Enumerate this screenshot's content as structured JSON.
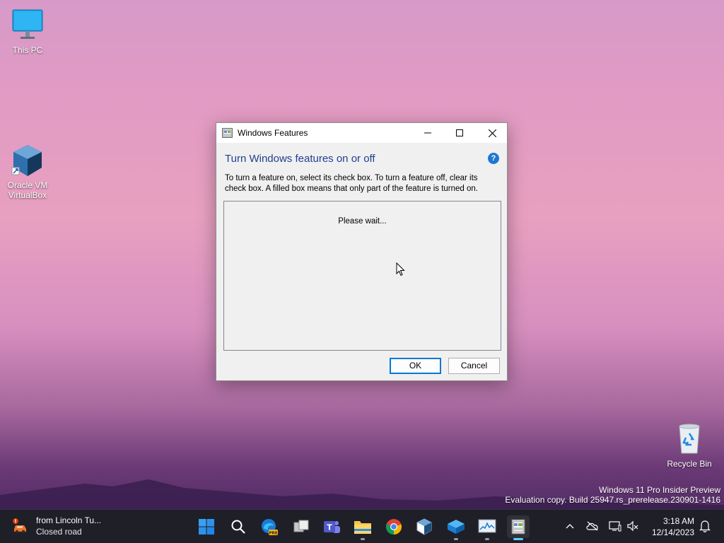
{
  "desktop": {
    "icons": [
      {
        "label": "This PC"
      },
      {
        "label": "Oracle VM VirtualBox"
      },
      {
        "label": "Recycle Bin"
      }
    ],
    "watermark": {
      "line1": "Windows 11 Pro Insider Preview",
      "line2": "Evaluation copy. Build 25947.rs_prerelease.230901-1416"
    }
  },
  "dialog": {
    "title": "Windows Features",
    "heading": "Turn Windows features on or off",
    "help_symbol": "?",
    "description": "To turn a feature on, select its check box. To turn a feature off, clear its check box. A filled box means that only part of the feature is turned on.",
    "status": "Please wait...",
    "ok_label": "OK",
    "cancel_label": "Cancel"
  },
  "taskbar": {
    "weather": {
      "line1": "from Lincoln Tu...",
      "line2": "Closed road"
    },
    "clock": {
      "time": "3:18 AM",
      "date": "12/14/2023"
    },
    "edge_badge": "PRE",
    "teams_letter": "T"
  },
  "colors": {
    "accent": "#0078d4",
    "heading": "#1f3f8f",
    "taskbar": "#1f1f28"
  }
}
